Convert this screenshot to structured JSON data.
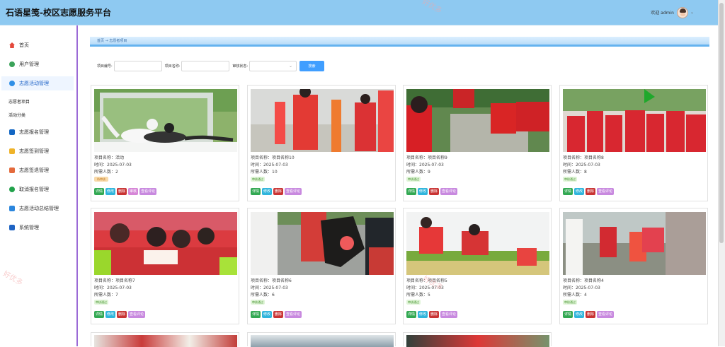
{
  "app": {
    "title": "石语星笺-校区志愿服务平台",
    "welcome": "欢迎 admin"
  },
  "sidebar": [
    {
      "label": "首页",
      "icon": "home-icon"
    },
    {
      "label": "用户管理",
      "icon": "user-icon"
    },
    {
      "label": "志愿活动管理",
      "icon": "activity-icon"
    },
    {
      "label": "志愿者项目",
      "icon": ""
    },
    {
      "label": "活动分类",
      "icon": ""
    },
    {
      "label": "志愿报名管理",
      "icon": "registration-icon"
    },
    {
      "label": "志愿签到管理",
      "icon": "sign-in-icon"
    },
    {
      "label": "志愿签退管理",
      "icon": "sign-out-icon"
    },
    {
      "label": "取消报名管理",
      "icon": "cancel-icon"
    },
    {
      "label": "志愿活动总结管理",
      "icon": "summary-icon"
    },
    {
      "label": "系统管理",
      "icon": "system-icon"
    }
  ],
  "breadcrumb": "首页 → 志愿者项目",
  "search": {
    "project_no": "项目编号:",
    "project_name": "项目名称:",
    "audit_status": "审核状态:",
    "button": "搜索"
  },
  "buttons": {
    "detail": "详情",
    "edit": "修改",
    "delete": "删除",
    "audit": "审核",
    "review": "查看评论"
  },
  "projects": [
    {
      "name": "项目名称：活动",
      "time": "时间：2025-07-03",
      "need": "所需人数：2",
      "status": "待审核",
      "status_color": "#f4d8a8"
    },
    {
      "name": "项目名称：项目名称10",
      "time": "时间：2025-07-03",
      "need": "所需人数：10",
      "status": "审核通过",
      "status_color": "#dff2d6"
    },
    {
      "name": "项目名称：项目名称9",
      "time": "时间：2025-07-03",
      "need": "所需人数：9",
      "status": "审核通过",
      "status_color": "#dff2d6"
    },
    {
      "name": "项目名称：项目名称8",
      "time": "时间：2025-07-03",
      "need": "所需人数：8",
      "status": "审核通过",
      "status_color": "#dff2d6"
    },
    {
      "name": "项目名称：项目名称7",
      "time": "时间：2025-07-03",
      "need": "所需人数：7",
      "status": "审核通过",
      "status_color": "#dff2d6"
    },
    {
      "name": "项目名称：项目名称6",
      "time": "时间：2025-07-03",
      "need": "所需人数：6",
      "status": "审核通过",
      "status_color": "#dff2d6"
    },
    {
      "name": "项目名称：项目名称5",
      "time": "时间：2025-07-03",
      "need": "所需人数：5",
      "status": "审核通过",
      "status_color": "#dff2d6"
    },
    {
      "name": "项目名称：项目名称4",
      "time": "时间：2025-07-03",
      "need": "所需人数：4",
      "status": "审核通过",
      "status_color": "#dff2d6"
    }
  ],
  "watermark": "好优多"
}
